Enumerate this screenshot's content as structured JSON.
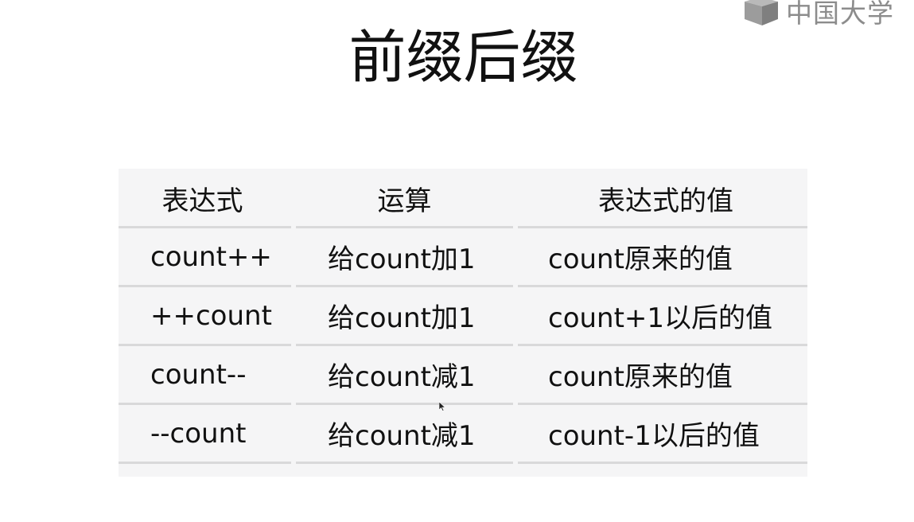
{
  "watermark": {
    "text": "中国大学",
    "icon": "mooc-cube-logo-icon"
  },
  "slide": {
    "title": "前缀后缀"
  },
  "table": {
    "headers": [
      "表达式",
      "运算",
      "表达式的值"
    ],
    "rows": [
      [
        "count++",
        "给count加1",
        "count原来的值"
      ],
      [
        "++count",
        "给count加1",
        "count+1以后的值"
      ],
      [
        "count--",
        "给count减1",
        "count原来的值"
      ],
      [
        "--count",
        "给count减1",
        "count-1以后的值"
      ]
    ]
  },
  "colors": {
    "table_background": "#f5f5f6",
    "row_divider": "#d9d9da",
    "text": "#111111",
    "watermark": "#8c8c8c"
  },
  "cursor": {
    "icon": "mouse-pointer-icon"
  }
}
